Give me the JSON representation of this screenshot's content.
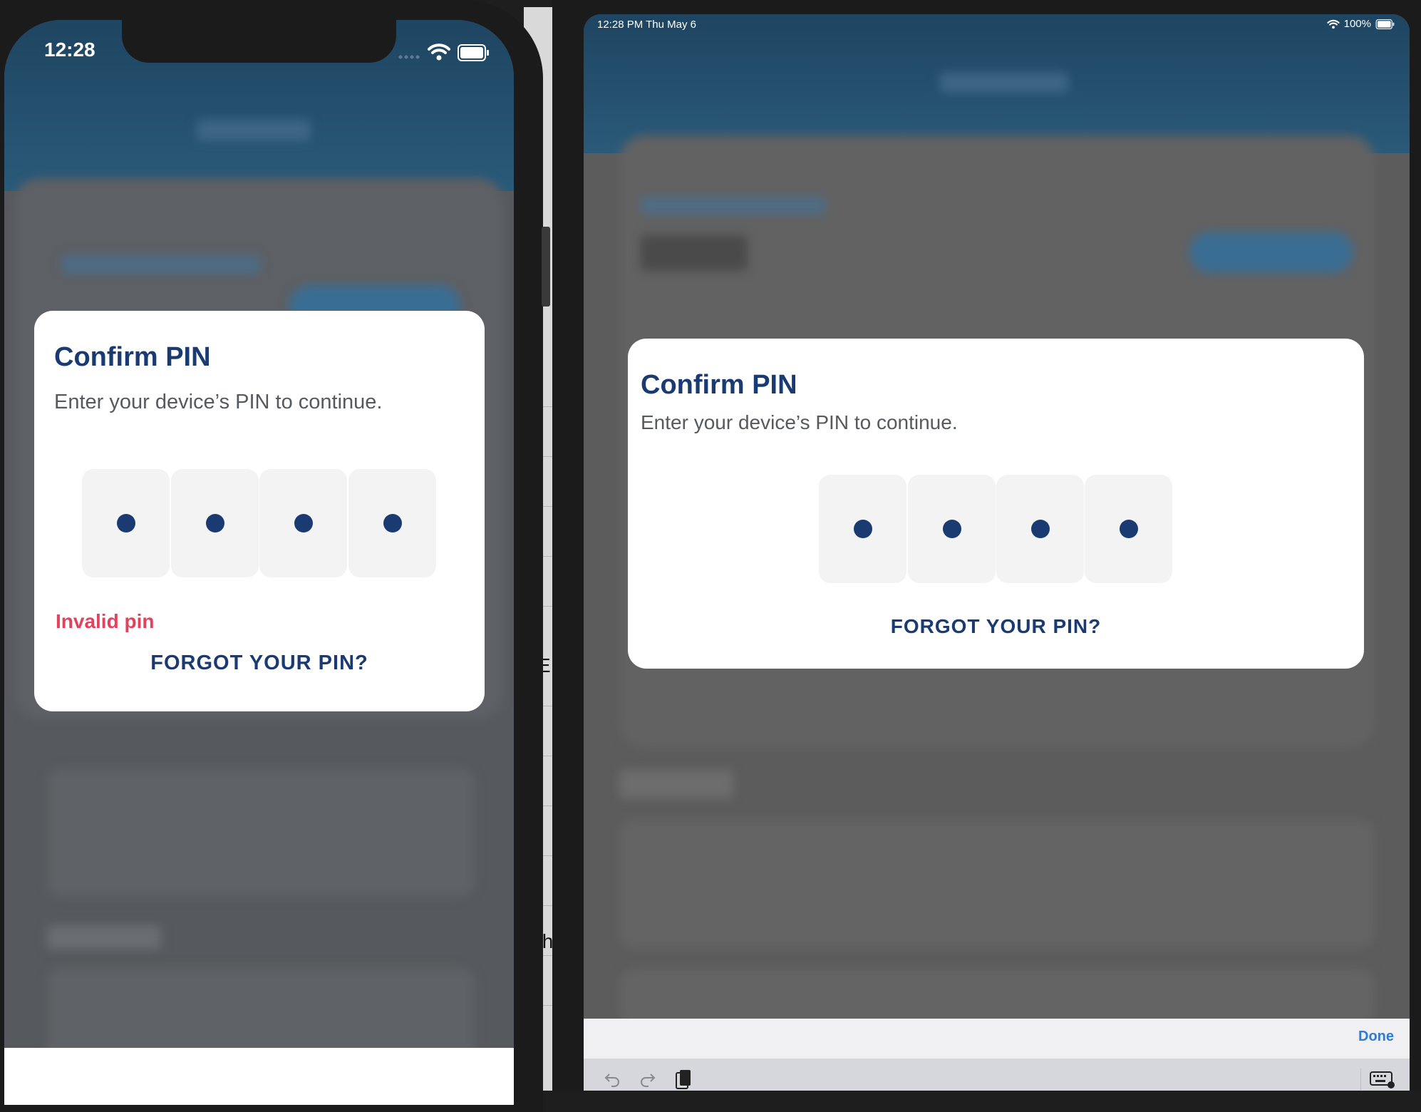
{
  "phone": {
    "status_time": "12:28",
    "modal": {
      "title": "Confirm PIN",
      "subtitle": "Enter your device’s PIN to continue.",
      "pin_digits_filled": 4,
      "error": "Invalid pin",
      "forgot_label": "FORGOT YOUR PIN?"
    }
  },
  "ipad": {
    "status_time": "12:28 PM   Thu May 6",
    "status_battery": "100%",
    "modal": {
      "title": "Confirm PIN",
      "subtitle": "Enter your device’s PIN to continue.",
      "pin_digits_filled": 4,
      "forgot_label": "FORGOT YOUR PIN?"
    },
    "keyboard_toolbar": {
      "done_label": "Done"
    }
  },
  "background_text": {
    "partial_e": "E",
    "partial_th": "th"
  },
  "colors": {
    "brand_navy": "#1a3a72",
    "error_red": "#e1425c",
    "link_blue": "#2f7bd8",
    "header_blue": "#1e4561"
  },
  "icons": [
    "wifi-icon",
    "battery-icon",
    "signal-icon",
    "undo-icon",
    "redo-icon",
    "clipboard-icon",
    "keyboard-icon"
  ]
}
